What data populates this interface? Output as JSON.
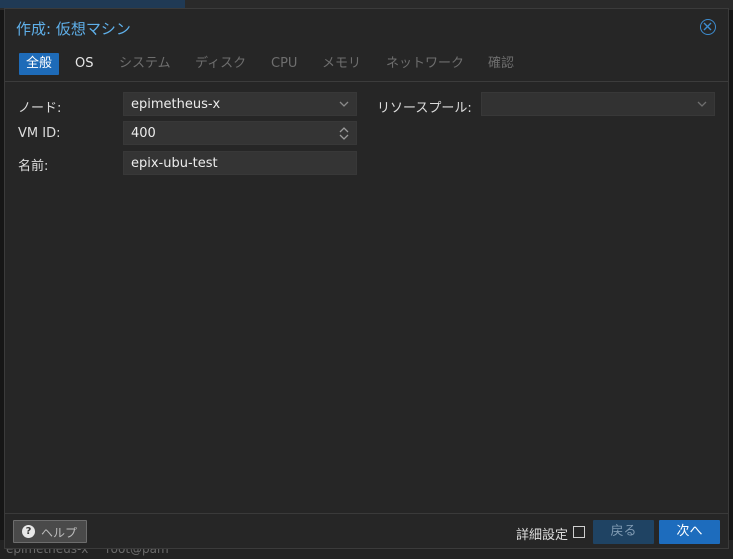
{
  "dialog": {
    "title": "作成: 仮想マシン"
  },
  "tabs": [
    {
      "label": "全般",
      "state": "active"
    },
    {
      "label": "OS",
      "state": "enabled"
    },
    {
      "label": "システム",
      "state": "disabled"
    },
    {
      "label": "ディスク",
      "state": "disabled"
    },
    {
      "label": "CPU",
      "state": "disabled"
    },
    {
      "label": "メモリ",
      "state": "disabled"
    },
    {
      "label": "ネットワーク",
      "state": "disabled"
    },
    {
      "label": "確認",
      "state": "disabled"
    }
  ],
  "form": {
    "node_label": "ノード:",
    "node_value": "epimetheus-x",
    "vmid_label": "VM ID:",
    "vmid_value": "400",
    "name_label": "名前:",
    "name_value": "epix-ubu-test",
    "pool_label": "リソースプール:",
    "pool_value": ""
  },
  "footer": {
    "help_label": "ヘルプ",
    "help_icon": "question-circle-icon",
    "advanced_label": "詳細設定",
    "advanced_checked": false,
    "back_label": "戻る",
    "next_label": "次へ"
  },
  "background": {
    "row_text_1": "epimetheus-x",
    "row_text_2": "root@pam"
  },
  "colors": {
    "accent": "#1e6bb8",
    "title": "#5fb0ea",
    "dialog_bg": "#262626"
  }
}
